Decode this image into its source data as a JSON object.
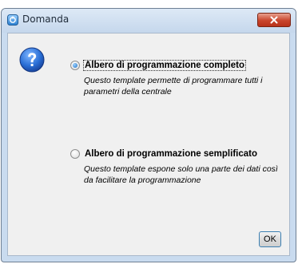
{
  "window": {
    "title": "Domanda",
    "title_icon": "app-icon",
    "close_icon": "close-icon"
  },
  "dialog": {
    "icon": "question-icon",
    "options": [
      {
        "label": "Albero di programmazione completo",
        "description": "Questo template permette di programmare tutti i parametri della centrale",
        "selected": true
      },
      {
        "label": "Albero di programmazione semplificato",
        "description": "Questo template espone solo una parte dei dati così da facilitare la programmazione",
        "selected": false
      }
    ],
    "ok_label": "OK"
  },
  "colors": {
    "window_frame": "#c9dbef",
    "client_bg": "#f0f0f0",
    "close_button": "#c9452c",
    "question_icon": "#1f5fbf"
  }
}
